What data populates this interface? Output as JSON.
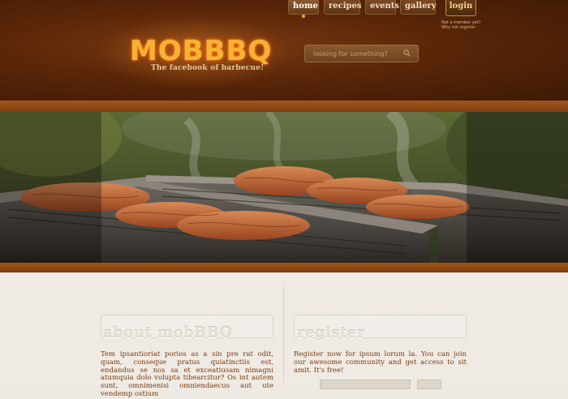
{
  "nav": {
    "home": "home",
    "recipes": "recipes",
    "events": "events",
    "gallery": "gallery",
    "login": "login"
  },
  "member_note": {
    "line1": "Not a member yet?",
    "line2": "Why not register."
  },
  "logo": {
    "title": "MOBBBQ",
    "tagline": "The facebook of barbecue!"
  },
  "search": {
    "placeholder": "looking for something?"
  },
  "about": {
    "title": "about mobBBQ",
    "text": "Tem ipsantioriat porios as a sin pre rat odit, quam, conseque pratus quiatinctiis est, endandus se nos sa et exceatiusam nimagni atumquia dolo volupta tibearcitur? Os int autem sunt, omnimenisi omniendaecus aut ute vendemp ostium"
  },
  "register": {
    "title": "register",
    "text": "Register now for ipsum lorum la. You can join our awesome community and get access to sit amit. It's free!"
  },
  "colors": {
    "header_bg": "#5a2608",
    "accent_orange": "#f3a52d",
    "bar": "#a1561c",
    "body_text": "#7a3a10",
    "content_bg": "#efebe4"
  }
}
